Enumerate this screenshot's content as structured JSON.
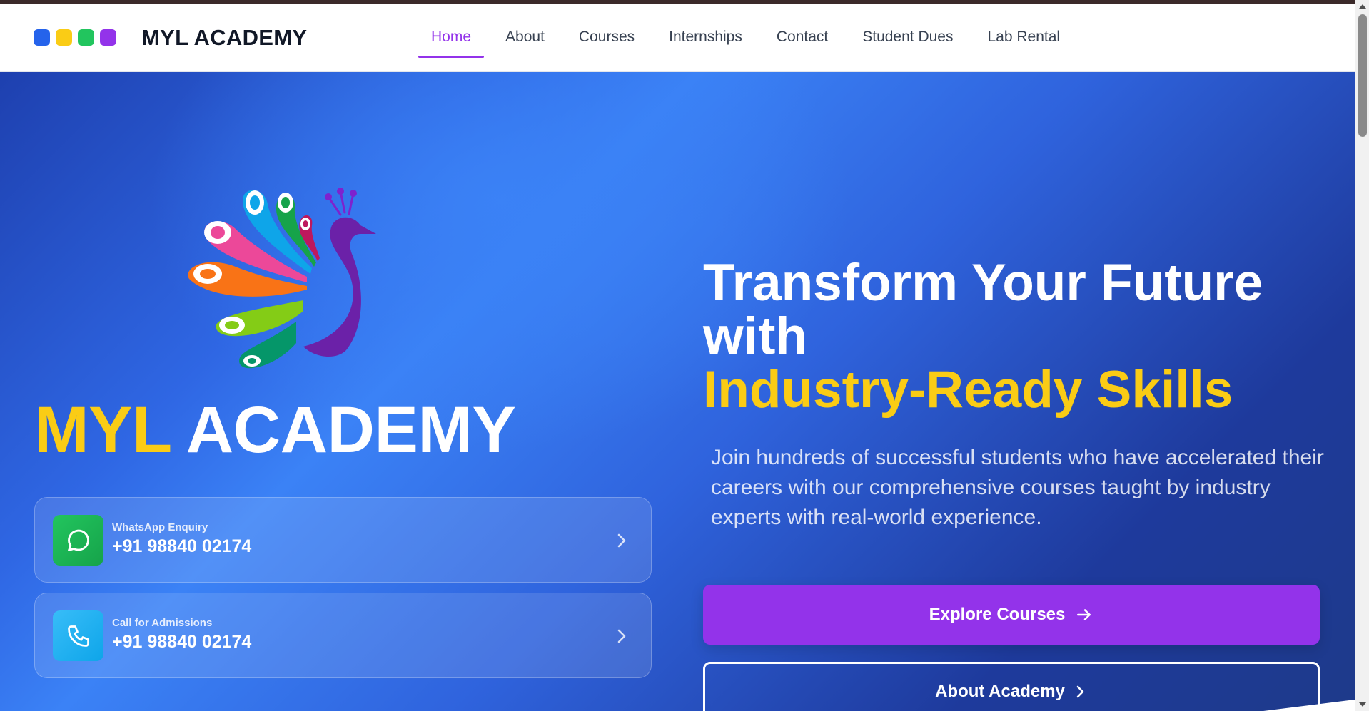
{
  "brand": {
    "name": "MYL ACADEMY",
    "dot_colors": [
      "#2563eb",
      "#facc15",
      "#22c55e",
      "#9333ea"
    ]
  },
  "nav": {
    "items": [
      {
        "label": "Home",
        "active": true
      },
      {
        "label": "About"
      },
      {
        "label": "Courses"
      },
      {
        "label": "Internships"
      },
      {
        "label": "Contact"
      },
      {
        "label": "Student Dues"
      },
      {
        "label": "Lab Rental"
      }
    ],
    "active_color": "#9333ea"
  },
  "hero": {
    "logo_icon": "peacock-logo-icon",
    "title_part1": "MYL",
    "title_part2": "ACADEMY",
    "headline": {
      "line1": "Transform Your Future",
      "line2": "with",
      "line3": "Industry-Ready Skills"
    },
    "subtext": "Join hundreds of successful students who have accelerated their careers with our comprehensive courses taught by industry experts with real-world experience.",
    "contacts": [
      {
        "label": "WhatsApp Enquiry",
        "number": "+91 98840 02174",
        "icon": "whatsapp-icon"
      },
      {
        "label": "Call for Admissions",
        "number": "+91 98840 02174",
        "icon": "phone-icon"
      }
    ],
    "buttons": {
      "primary": "Explore Courses",
      "secondary": "About Academy"
    },
    "accent_yellow": "#facc15",
    "button_purple": "#9333ea"
  }
}
